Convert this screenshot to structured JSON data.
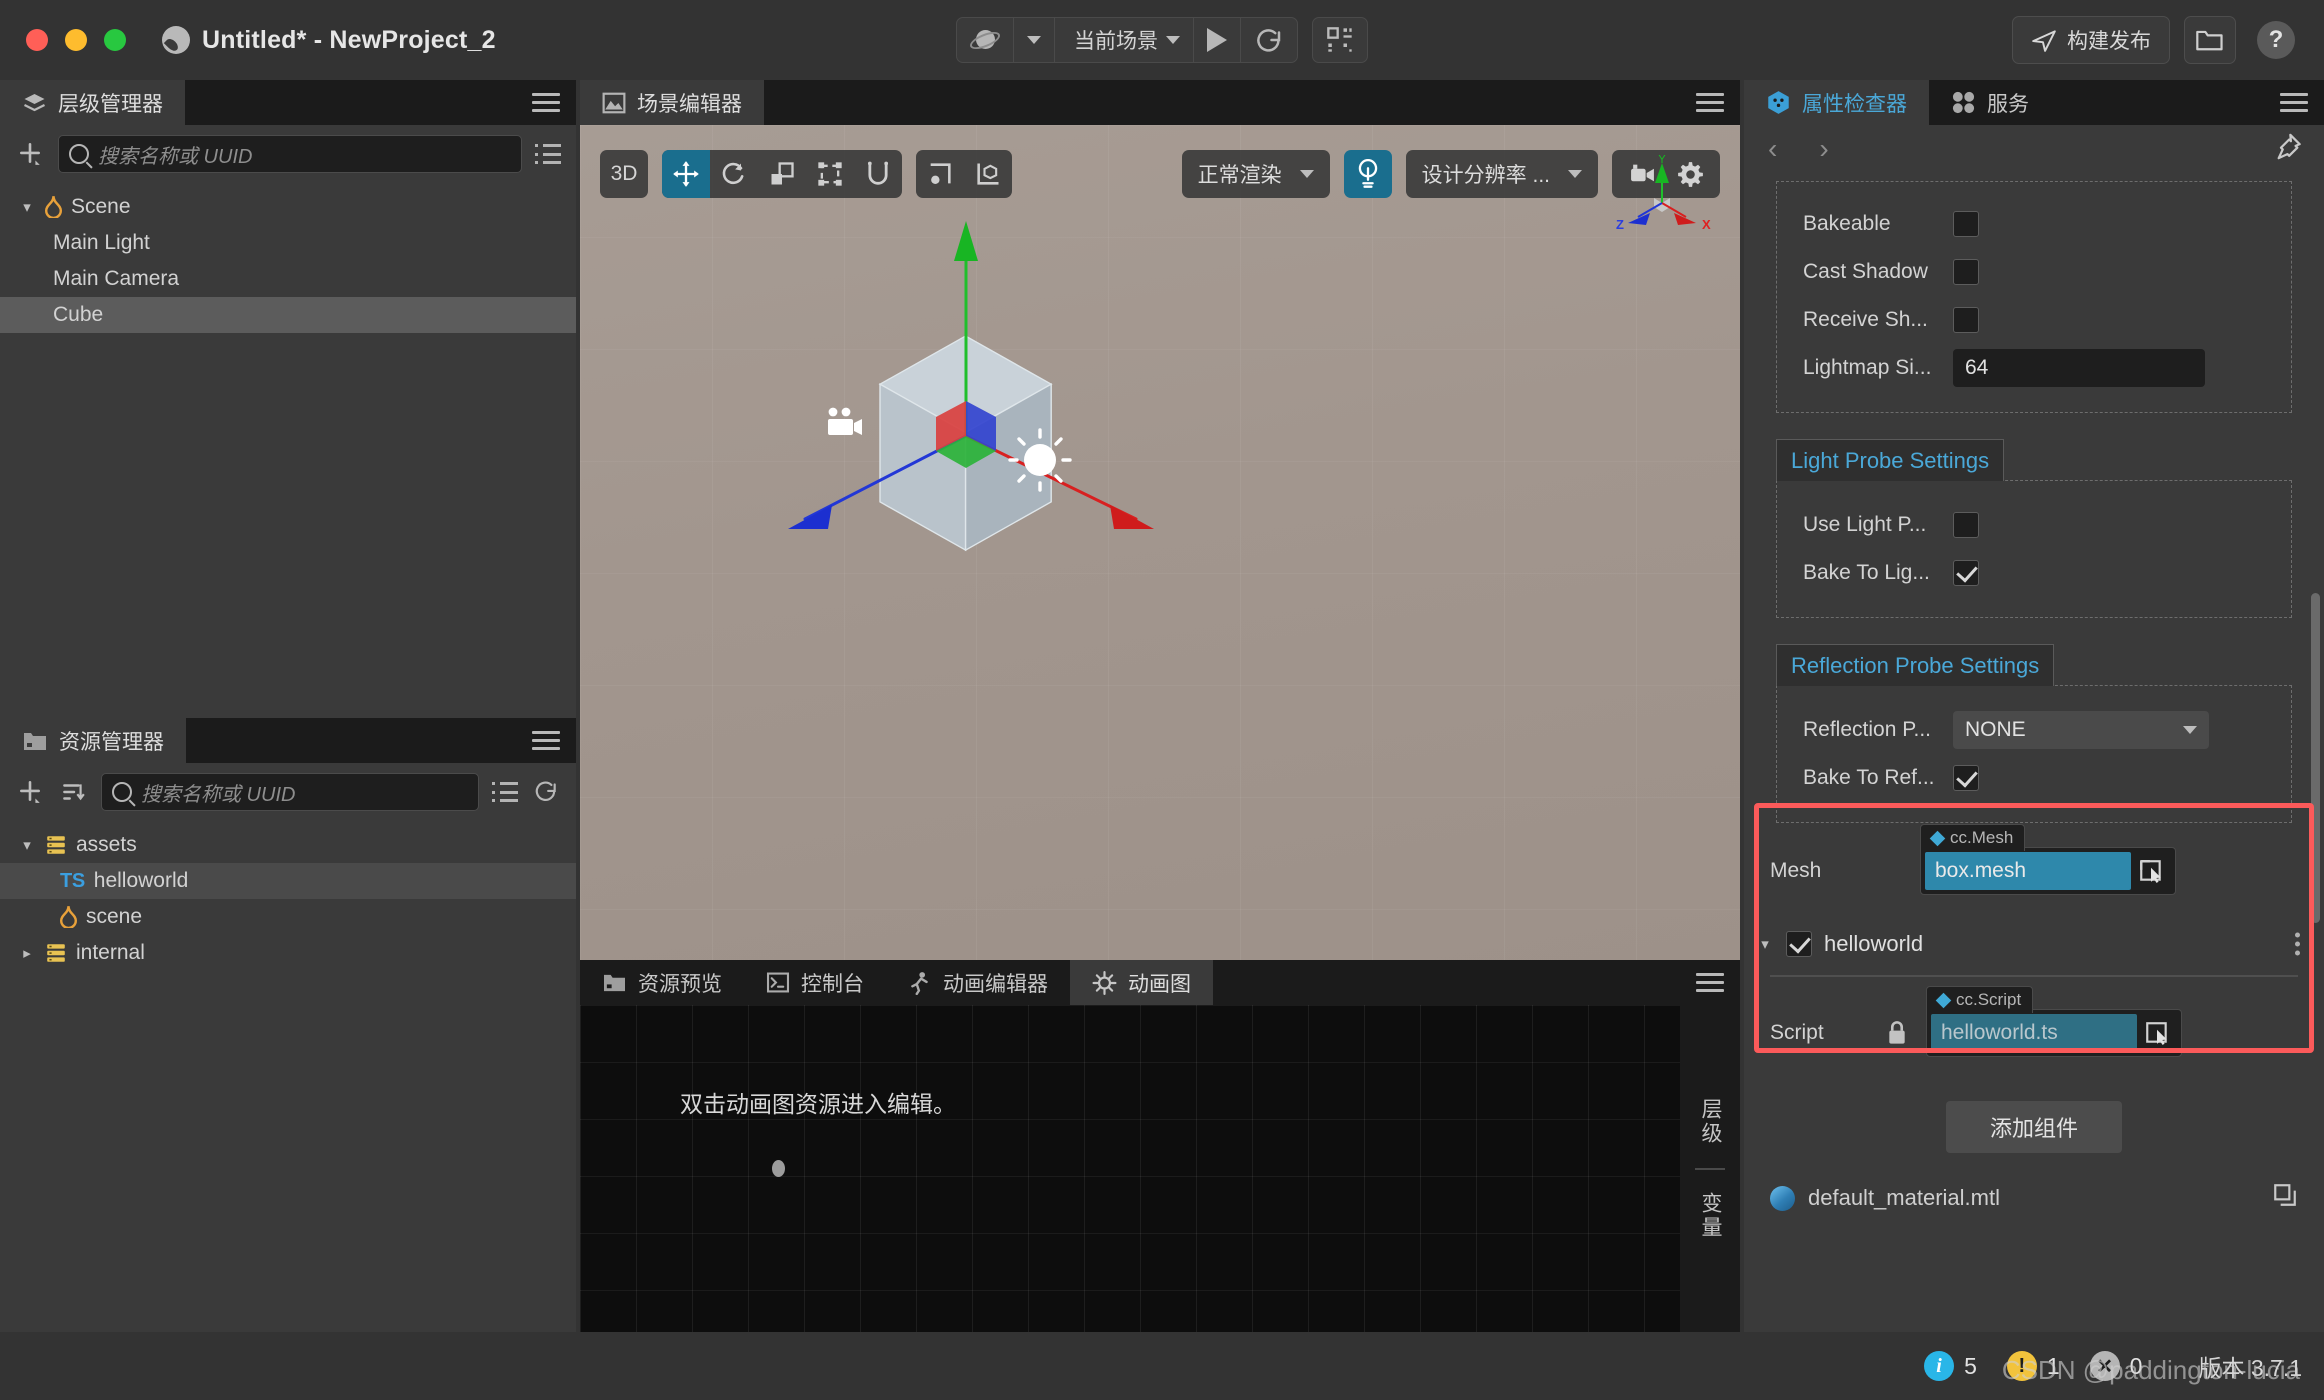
{
  "window": {
    "title": "Untitled* - NewProject_2",
    "logo_icon": "cocos-flame-icon"
  },
  "toolbar": {
    "platform_icon": "planet-icon",
    "platform_caret_icon": "chevron-down-icon",
    "scene_select": "当前场景",
    "scene_caret_icon": "chevron-down-icon",
    "play_icon": "play-icon",
    "refresh_icon": "refresh-icon",
    "qr_icon": "qr-code-icon",
    "build_label": "构建发布",
    "build_icon": "send-icon",
    "folder_icon": "folder-open-icon",
    "help_icon": "help-icon"
  },
  "hierarchy": {
    "tab_label": "层级管理器",
    "tab_icon": "layers-icon",
    "menu_icon": "hamburger-icon",
    "add_icon": "add-node-icon",
    "search_placeholder": "搜索名称或 UUID",
    "search_value": "",
    "search_icon": "search-icon",
    "filter_icon": "list-filter-icon",
    "nodes": [
      {
        "label": "Scene",
        "icon": "flame-icon",
        "caret": "▾",
        "depth": 0,
        "selected": false
      },
      {
        "label": "Main Light",
        "icon": "",
        "caret": "",
        "depth": 1,
        "selected": false
      },
      {
        "label": "Main Camera",
        "icon": "",
        "caret": "",
        "depth": 1,
        "selected": false
      },
      {
        "label": "Cube",
        "icon": "",
        "caret": "",
        "depth": 1,
        "selected": true
      }
    ]
  },
  "assets": {
    "tab_label": "资源管理器",
    "tab_icon": "folder-icon",
    "menu_icon": "hamburger-icon",
    "add_icon": "add-asset-icon",
    "sort_icon": "sort-icon",
    "search_placeholder": "搜索名称或 UUID",
    "search_value": "",
    "search_icon": "search-icon",
    "list_icon": "list-view-icon",
    "refresh_icon": "refresh-icon",
    "nodes": [
      {
        "label": "assets",
        "icon": "db-icon",
        "caret": "▾",
        "depth": 0,
        "selected": false
      },
      {
        "label": "helloworld",
        "icon": "ts-icon",
        "caret": "",
        "depth": 1,
        "selected": true
      },
      {
        "label": "scene",
        "icon": "flame-icon",
        "caret": "",
        "depth": 1,
        "selected": false
      },
      {
        "label": "internal",
        "icon": "db-icon",
        "caret": "▸",
        "depth": 0,
        "selected": false
      }
    ]
  },
  "scene": {
    "tab_label": "场景编辑器",
    "tab_icon": "scene-icon",
    "menu_icon": "hamburger-icon",
    "mode_label": "3D",
    "tools": [
      {
        "name": "move-tool",
        "icon": "move-icon",
        "active": true
      },
      {
        "name": "rotate-tool",
        "icon": "rotate-icon",
        "active": false
      },
      {
        "name": "scale-tool",
        "icon": "scale-icon",
        "active": false
      },
      {
        "name": "rect-tool",
        "icon": "rect-transform-icon",
        "active": false
      },
      {
        "name": "magnet-tool",
        "icon": "magnet-icon",
        "active": false
      }
    ],
    "pivot_icon": "pivot-icon",
    "coord_icon": "coordinate-icon",
    "render_mode": "正常渲染",
    "render_caret_icon": "chevron-down-icon",
    "light_icon": "lightbulb-icon",
    "resolution": "设计分辨率 ...",
    "resolution_caret_icon": "chevron-down-icon",
    "camera_icon": "camera-icon",
    "gear_icon": "gear-icon",
    "gizmo_axes": [
      "X",
      "Y",
      "Z"
    ],
    "camera_marker_icon": "camera-marker-icon",
    "light_marker_icon": "sun-marker-icon"
  },
  "dock": {
    "tabs": [
      {
        "label": "资源预览",
        "icon": "asset-preview-icon",
        "active": false
      },
      {
        "label": "控制台",
        "icon": "console-icon",
        "active": false
      },
      {
        "label": "动画编辑器",
        "icon": "animation-editor-icon",
        "active": false
      },
      {
        "label": "动画图",
        "icon": "animation-graph-icon",
        "active": true
      }
    ],
    "menu_icon": "hamburger-icon",
    "hint": "双击动画图资源进入编辑。",
    "side_labels": [
      "层级",
      "变量"
    ]
  },
  "inspector": {
    "tabs": [
      {
        "label": "属性检查器",
        "icon": "inspector-icon",
        "active": true
      },
      {
        "label": "服务",
        "icon": "services-icon",
        "active": false
      }
    ],
    "menu_icon": "hamburger-icon",
    "back_icon": "chevron-left-icon",
    "forward_icon": "chevron-right-icon",
    "pin_icon": "pin-icon",
    "renderer_fields": [
      {
        "label": "Bakeable",
        "type": "checkbox",
        "checked": false
      },
      {
        "label": "Cast Shadow",
        "type": "checkbox",
        "checked": false
      },
      {
        "label": "Receive Sh...",
        "type": "checkbox",
        "checked": false
      },
      {
        "label": "Lightmap Si...",
        "type": "number",
        "value": "64"
      }
    ],
    "light_probe": {
      "title": "Light Probe Settings",
      "fields": [
        {
          "label": "Use Light P...",
          "type": "checkbox",
          "checked": false
        },
        {
          "label": "Bake To Lig...",
          "type": "checkbox",
          "checked": true
        }
      ]
    },
    "reflection_probe": {
      "title": "Reflection Probe Settings",
      "fields": [
        {
          "label": "Reflection P...",
          "type": "select",
          "value": "NONE",
          "caret_icon": "chevron-down-icon"
        },
        {
          "label": "Bake To Ref...",
          "type": "checkbox",
          "checked": true
        }
      ]
    },
    "mesh": {
      "label": "Mesh",
      "tag": "cc.Mesh",
      "value": "box.mesh",
      "pick_icon": "asset-pick-icon"
    },
    "component": {
      "name": "helloworld",
      "enabled": true,
      "caret": "▾",
      "menu_icon": "more-vertical-icon"
    },
    "script": {
      "label": "Script",
      "lock_icon": "lock-icon",
      "tag": "cc.Script",
      "value": "helloworld.ts",
      "pick_icon": "asset-pick-icon"
    },
    "add_component_label": "添加组件",
    "material": {
      "label": "default_material.mtl",
      "icon": "material-ball-icon",
      "copy_icon": "duplicate-icon"
    },
    "highlight_color": "#fb5a5a"
  },
  "statusbar": {
    "info_count": "5",
    "warn_count": "1",
    "error_count": "0",
    "info_icon": "info-icon",
    "warn_icon": "warning-icon",
    "error_icon": "error-icon",
    "version": "版本 3.7.1",
    "watermark": "CSDN @paddington-lucia"
  },
  "colors": {
    "accent": "#4aa8d8",
    "tool_active": "#1a6e8e",
    "selection": "#5c5c5c",
    "panel": "#3a3a3a",
    "highlight": "#fb5a5a"
  }
}
